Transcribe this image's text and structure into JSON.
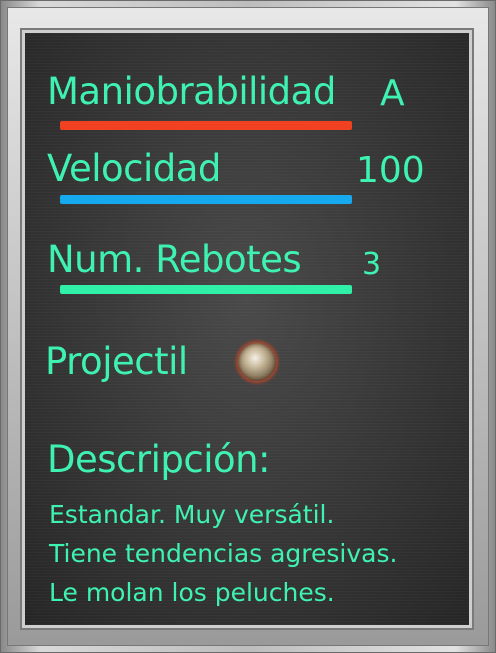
{
  "stats": [
    {
      "label": "Maniobrabilidad",
      "value": "A",
      "bar_color": "#f04020"
    },
    {
      "label": "Velocidad",
      "value": "100",
      "bar_color": "#14a8ee"
    },
    {
      "label": "Num. Rebotes",
      "value": "3",
      "bar_color": "#2ef0a6"
    }
  ],
  "projectile": {
    "label": "Projectil",
    "icon": "ball-icon"
  },
  "description": {
    "title": "Descripción:",
    "lines": [
      "Estandar. Muy versátil.",
      "Tiene tendencias agresivas.",
      "Le molan los peluches."
    ]
  },
  "colors": {
    "text": "#3df2b0",
    "panel": "#333333",
    "frame": "#c4c4c4"
  }
}
